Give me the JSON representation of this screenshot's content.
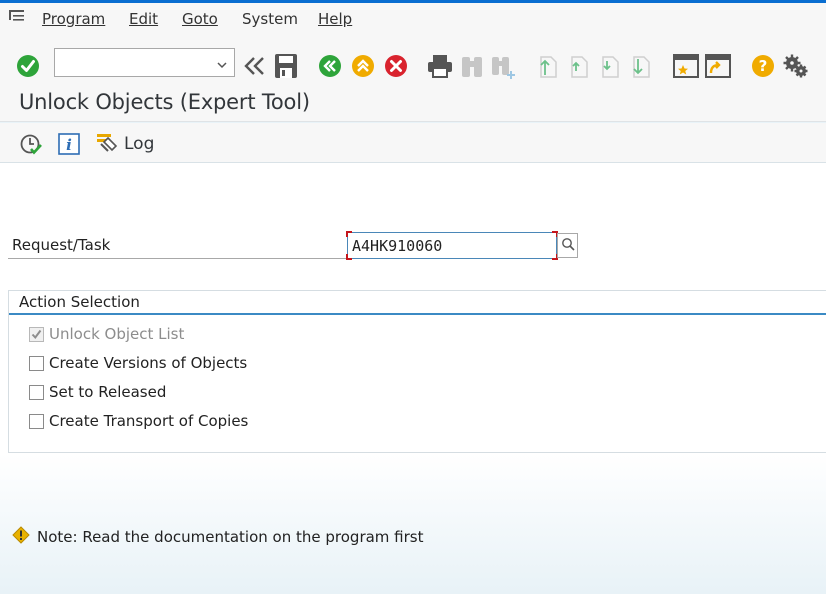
{
  "menubar": {
    "items": [
      {
        "label": "Program"
      },
      {
        "label": "Edit"
      },
      {
        "label": "Goto"
      },
      {
        "label": "System"
      },
      {
        "label": "Help"
      }
    ]
  },
  "toolbar": {
    "command_field_value": "",
    "icons": [
      "enter-icon",
      "back-arrows-icon",
      "save-icon",
      "back-icon",
      "exit-icon",
      "cancel-icon",
      "print-icon",
      "find-icon",
      "find-next-icon",
      "first-page-icon",
      "previous-page-icon",
      "next-page-icon",
      "last-page-icon",
      "create-session-icon",
      "generate-shortcut-icon",
      "help-icon",
      "customize-layout-icon"
    ]
  },
  "page": {
    "title": "Unlock Objects (Expert Tool)"
  },
  "app_toolbar": {
    "log_label": "Log",
    "icons": [
      "execute-icon",
      "info-icon",
      "log-icon"
    ]
  },
  "form": {
    "request_label": "Request/Task",
    "request_value": "A4HK910060",
    "group_title": "Action Selection",
    "options": [
      {
        "label": "Unlock Object List",
        "checked": true,
        "disabled": true
      },
      {
        "label": "Create Versions of Objects",
        "checked": false,
        "disabled": false
      },
      {
        "label": "Set to Released",
        "checked": false,
        "disabled": false
      },
      {
        "label": "Create Transport of Copies",
        "checked": false,
        "disabled": false
      }
    ]
  },
  "note": {
    "text": "Note: Read the documentation on the program first"
  },
  "colors": {
    "accent": "#0a6ed1",
    "green": "#2ea43a",
    "orange": "#f0ab00",
    "red": "#d9232e",
    "warning": "#e9b200"
  }
}
